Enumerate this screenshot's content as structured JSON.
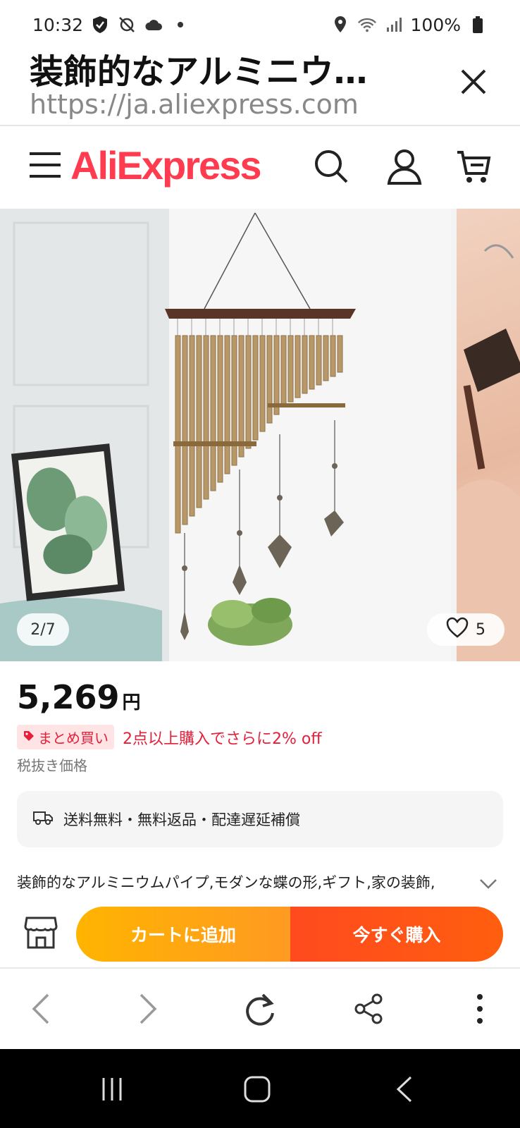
{
  "status_bar": {
    "time": "10:32",
    "battery": "100%",
    "icons": [
      "shield-icon",
      "sync-off-icon",
      "cloud-icon",
      "dot-icon",
      "location-icon",
      "wifi-icon",
      "signal-icon",
      "battery-icon"
    ]
  },
  "tab": {
    "title": "装飾的なアルミニウ…",
    "url": "https://ja.aliexpress.com"
  },
  "site": {
    "logo": "AliExpress"
  },
  "gallery": {
    "counter": "2/7",
    "wishlist_count": "5"
  },
  "product": {
    "price": "5,269",
    "currency": "円",
    "promo_badge": "まとめ買い",
    "promo_text": "2点以上購入でさらに2% off",
    "tax_note": "税抜き価格",
    "shipping": "送料無料・無料返品・配達遅延補償",
    "description": "装飾的なアルミニウムパイプ,モダンな蝶の形,ギフト,家の装飾,"
  },
  "actions": {
    "add_to_cart": "カートに追加",
    "buy_now": "今すぐ購入"
  },
  "colors": {
    "brand": "#ff3b4f",
    "cart_button": "#ffb400",
    "buy_button": "#ff4a1e",
    "promo": "#e4203a"
  }
}
